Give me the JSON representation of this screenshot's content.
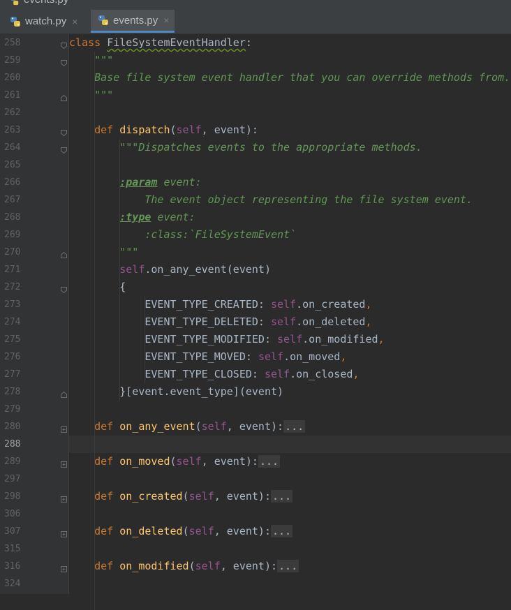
{
  "title_strip": {
    "text": "events.py"
  },
  "tabs": [
    {
      "label": "watch.py",
      "close": "×",
      "active": false
    },
    {
      "label": "events.py",
      "close": "×",
      "active": true
    }
  ],
  "colors": {
    "keyword": "#cc7832",
    "function": "#ffc66d",
    "self": "#94558d",
    "docstring": "#629755",
    "text": "#a9b7c6",
    "background": "#2b2b2b",
    "gutter": "#313335"
  },
  "lines": [
    {
      "num": "258",
      "fold": "open",
      "tokens": [
        [
          "kw",
          "class "
        ],
        [
          "clsname",
          "FileSystemEventHandler"
        ],
        [
          "p",
          ":"
        ]
      ]
    },
    {
      "num": "259",
      "fold": "open",
      "tokens": [
        [
          "ind",
          "    "
        ],
        [
          "doc",
          "\"\"\""
        ]
      ]
    },
    {
      "num": "260",
      "fold": "",
      "tokens": [
        [
          "ind",
          "    "
        ],
        [
          "doc",
          "Base file system event handler that you can override methods from."
        ]
      ]
    },
    {
      "num": "261",
      "fold": "close",
      "tokens": [
        [
          "ind",
          "    "
        ],
        [
          "doc",
          "\"\"\""
        ]
      ]
    },
    {
      "num": "262",
      "fold": "",
      "tokens": []
    },
    {
      "num": "263",
      "fold": "open",
      "tokens": [
        [
          "ind",
          "    "
        ],
        [
          "kw",
          "def "
        ],
        [
          "fn",
          "dispatch"
        ],
        [
          "p",
          "("
        ],
        [
          "self",
          "self"
        ],
        [
          "p",
          ", event):"
        ]
      ]
    },
    {
      "num": "264",
      "fold": "open",
      "tokens": [
        [
          "ind",
          "        "
        ],
        [
          "doc",
          "\"\"\"Dispatches events to the appropriate methods."
        ]
      ]
    },
    {
      "num": "265",
      "fold": "",
      "tokens": []
    },
    {
      "num": "266",
      "fold": "",
      "tokens": [
        [
          "ind",
          "        "
        ],
        [
          "dtag",
          ":param"
        ],
        [
          "doc",
          " event:"
        ]
      ]
    },
    {
      "num": "267",
      "fold": "",
      "tokens": [
        [
          "ind",
          "            "
        ],
        [
          "doc",
          "The event object representing the file system event."
        ]
      ]
    },
    {
      "num": "268",
      "fold": "",
      "tokens": [
        [
          "ind",
          "        "
        ],
        [
          "dtag",
          ":type"
        ],
        [
          "doc",
          " event:"
        ]
      ]
    },
    {
      "num": "269",
      "fold": "",
      "tokens": [
        [
          "ind",
          "            "
        ],
        [
          "doc",
          ":class:`FileSystemEvent`"
        ]
      ]
    },
    {
      "num": "270",
      "fold": "close",
      "tokens": [
        [
          "ind",
          "        "
        ],
        [
          "doc",
          "\"\"\""
        ]
      ]
    },
    {
      "num": "271",
      "fold": "",
      "tokens": [
        [
          "ind",
          "        "
        ],
        [
          "self",
          "self"
        ],
        [
          "p",
          ".on_any_event(event)"
        ]
      ]
    },
    {
      "num": "272",
      "fold": "open",
      "tokens": [
        [
          "ind",
          "        "
        ],
        [
          "p",
          "{"
        ]
      ]
    },
    {
      "num": "273",
      "fold": "",
      "tokens": [
        [
          "ind",
          "            "
        ],
        [
          "p",
          "EVENT_TYPE_CREATED: "
        ],
        [
          "self",
          "self"
        ],
        [
          "p",
          ".on_created"
        ],
        [
          "kw",
          ","
        ]
      ]
    },
    {
      "num": "274",
      "fold": "",
      "tokens": [
        [
          "ind",
          "            "
        ],
        [
          "p",
          "EVENT_TYPE_DELETED: "
        ],
        [
          "self",
          "self"
        ],
        [
          "p",
          ".on_deleted"
        ],
        [
          "kw",
          ","
        ]
      ]
    },
    {
      "num": "275",
      "fold": "",
      "tokens": [
        [
          "ind",
          "            "
        ],
        [
          "p",
          "EVENT_TYPE_MODIFIED: "
        ],
        [
          "self",
          "self"
        ],
        [
          "p",
          ".on_modified"
        ],
        [
          "kw",
          ","
        ]
      ]
    },
    {
      "num": "276",
      "fold": "",
      "tokens": [
        [
          "ind",
          "            "
        ],
        [
          "p",
          "EVENT_TYPE_MOVED: "
        ],
        [
          "self",
          "self"
        ],
        [
          "p",
          ".on_moved"
        ],
        [
          "kw",
          ","
        ]
      ]
    },
    {
      "num": "277",
      "fold": "",
      "tokens": [
        [
          "ind",
          "            "
        ],
        [
          "p",
          "EVENT_TYPE_CLOSED: "
        ],
        [
          "self",
          "self"
        ],
        [
          "p",
          ".on_closed"
        ],
        [
          "kw",
          ","
        ]
      ]
    },
    {
      "num": "278",
      "fold": "close",
      "tokens": [
        [
          "ind",
          "        "
        ],
        [
          "p",
          "}[event.event_type](event)"
        ]
      ]
    },
    {
      "num": "279",
      "fold": "",
      "tokens": []
    },
    {
      "num": "280",
      "fold": "plus",
      "tokens": [
        [
          "ind",
          "    "
        ],
        [
          "kw",
          "def "
        ],
        [
          "fn",
          "on_any_event"
        ],
        [
          "p",
          "("
        ],
        [
          "self",
          "self"
        ],
        [
          "p",
          ", event):"
        ],
        [
          "ellip",
          "..."
        ]
      ]
    },
    {
      "num": "288",
      "fold": "",
      "tokens": [],
      "current": true
    },
    {
      "num": "289",
      "fold": "plus",
      "tokens": [
        [
          "ind",
          "    "
        ],
        [
          "kw",
          "def "
        ],
        [
          "fn",
          "on_moved"
        ],
        [
          "p",
          "("
        ],
        [
          "self",
          "self"
        ],
        [
          "p",
          ", event):"
        ],
        [
          "ellip",
          "..."
        ]
      ]
    },
    {
      "num": "297",
      "fold": "",
      "tokens": []
    },
    {
      "num": "298",
      "fold": "plus",
      "tokens": [
        [
          "ind",
          "    "
        ],
        [
          "kw",
          "def "
        ],
        [
          "fn",
          "on_created"
        ],
        [
          "p",
          "("
        ],
        [
          "self",
          "self"
        ],
        [
          "p",
          ", event):"
        ],
        [
          "ellip",
          "..."
        ]
      ]
    },
    {
      "num": "306",
      "fold": "",
      "tokens": []
    },
    {
      "num": "307",
      "fold": "plus",
      "tokens": [
        [
          "ind",
          "    "
        ],
        [
          "kw",
          "def "
        ],
        [
          "fn",
          "on_deleted"
        ],
        [
          "p",
          "("
        ],
        [
          "self",
          "self"
        ],
        [
          "p",
          ", event):"
        ],
        [
          "ellip",
          "..."
        ]
      ]
    },
    {
      "num": "315",
      "fold": "",
      "tokens": []
    },
    {
      "num": "316",
      "fold": "plus",
      "tokens": [
        [
          "ind",
          "    "
        ],
        [
          "kw",
          "def "
        ],
        [
          "fn",
          "on_modified"
        ],
        [
          "p",
          "("
        ],
        [
          "self",
          "self"
        ],
        [
          "p",
          ", event):"
        ],
        [
          "ellip",
          "..."
        ]
      ]
    },
    {
      "num": "324",
      "fold": "",
      "tokens": []
    }
  ]
}
